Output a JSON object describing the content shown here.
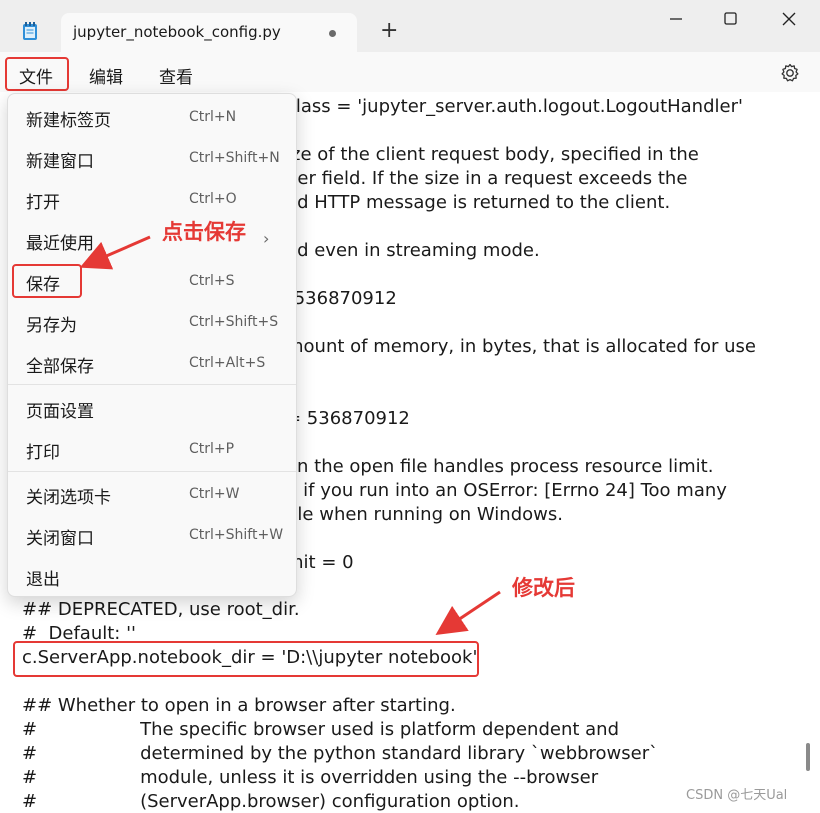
{
  "window": {
    "tab_title": "jupyter_notebook_config.py",
    "new_tab_symbol": "+",
    "icons": [
      "notepad-icon",
      "minimize-icon",
      "maximize-icon",
      "close-icon",
      "gear-icon"
    ]
  },
  "menubar": {
    "file": "文件",
    "edit": "编辑",
    "view": "查看"
  },
  "file_menu": {
    "items": [
      {
        "label": "新建标签页",
        "shortcut": "Ctrl+N"
      },
      {
        "label": "新建窗口",
        "shortcut": "Ctrl+Shift+N"
      },
      {
        "label": "打开",
        "shortcut": "Ctrl+O"
      },
      {
        "label": "最近使用",
        "shortcut": "",
        "submenu_arrow": "›"
      },
      {
        "label": "保存",
        "shortcut": "Ctrl+S"
      },
      {
        "label": "另存为",
        "shortcut": "Ctrl+Shift+S"
      },
      {
        "label": "全部保存",
        "shortcut": "Ctrl+Alt+S"
      },
      {
        "label": "页面设置",
        "shortcut": ""
      },
      {
        "label": "打印",
        "shortcut": "Ctrl+P"
      },
      {
        "label": "关闭选项卡",
        "shortcut": "Ctrl+W"
      },
      {
        "label": "关闭窗口",
        "shortcut": "Ctrl+Shift+W"
      },
      {
        "label": "退出",
        "shortcut": ""
      }
    ]
  },
  "editor": {
    "lines": [
      "class = 'jupyter_server.auth.logout.LogoutHandler'",
      "ize of the client request body, specified in the",
      "der field. If the size in a request exceeds the",
      "ed HTTP message is returned to the client.",
      "ed even in streaming mode.",
      " 536870912",
      "mount of memory, in bytes, that is allocated for use",
      "= 536870912",
      "on the open file handles process resource limit.",
      "d if you run into an OSError: [Errno 24] Too many",
      "ble when running on Windows.",
      "mit = 0",
      "## DEPRECATED, use root_dir.",
      "#  Default: ''",
      "c.ServerApp.notebook_dir = 'D:\\\\jupyter notebook'",
      "## Whether to open in a browser after starting.",
      "#                  The specific browser used is platform dependent and",
      "#                  determined by the python standard library `webbrowser`",
      "#                  module, unless it is overridden using the --browser",
      "#                  (ServerApp.browser) configuration option."
    ]
  },
  "annotations": {
    "click_save": "点击保存",
    "after_edit": "修改后",
    "accent_color": "#e53935"
  },
  "watermark": "CSDN @七天Ual"
}
